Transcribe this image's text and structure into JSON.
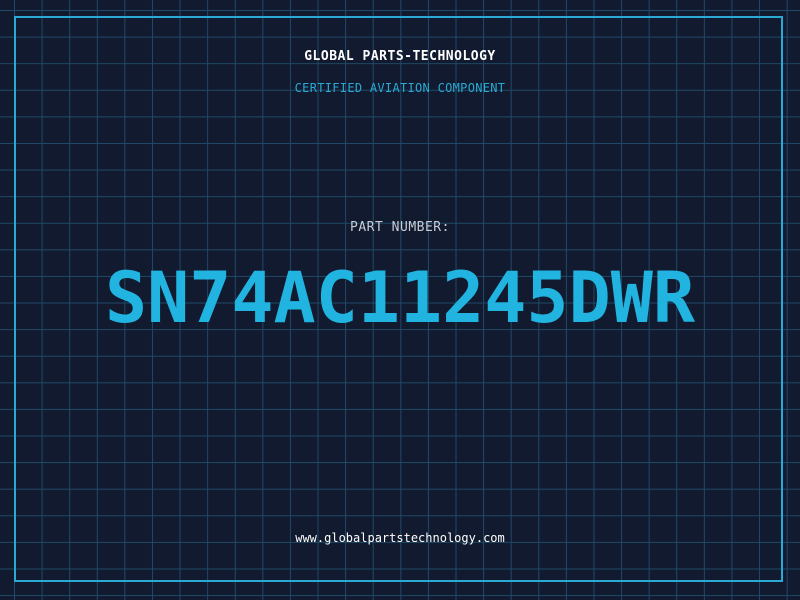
{
  "header": {
    "company": "GLOBAL PARTS-TECHNOLOGY",
    "tagline": "CERTIFIED AVIATION COMPONENT"
  },
  "part": {
    "label": "PART NUMBER:",
    "number": "SN74AC11245DWR"
  },
  "footer": {
    "url": "www.globalpartstechnology.com"
  },
  "colors": {
    "background": "#111a2e",
    "grid": "#1f4a68",
    "accent": "#2aa9d4",
    "part_number": "#21b4e0",
    "text": "#ffffff"
  }
}
